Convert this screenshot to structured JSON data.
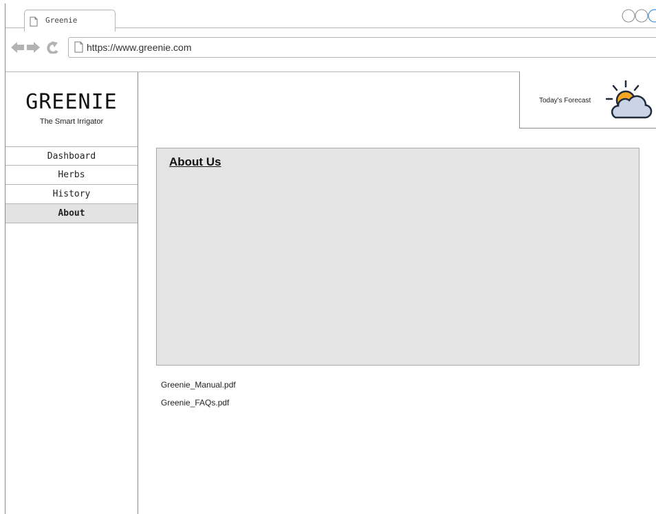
{
  "browser": {
    "tab_title": "Greenie",
    "url": "https://www.greenie.com"
  },
  "sidebar": {
    "brand": "GREENIE",
    "tagline": "The Smart Irrigator",
    "nav": [
      {
        "label": "Dashboard",
        "active": false
      },
      {
        "label": "Herbs",
        "active": false
      },
      {
        "label": "History",
        "active": false
      },
      {
        "label": "About",
        "active": true
      }
    ]
  },
  "forecast": {
    "label": "Today's Forecast",
    "icon": "partly-cloudy-icon",
    "sun_color": "#f5a623",
    "cloud_color": "#c9d4e6"
  },
  "about": {
    "title": "About Us"
  },
  "files": [
    {
      "name": "Greenie_Manual.pdf"
    },
    {
      "name": "Greenie_FAQs.pdf"
    }
  ]
}
